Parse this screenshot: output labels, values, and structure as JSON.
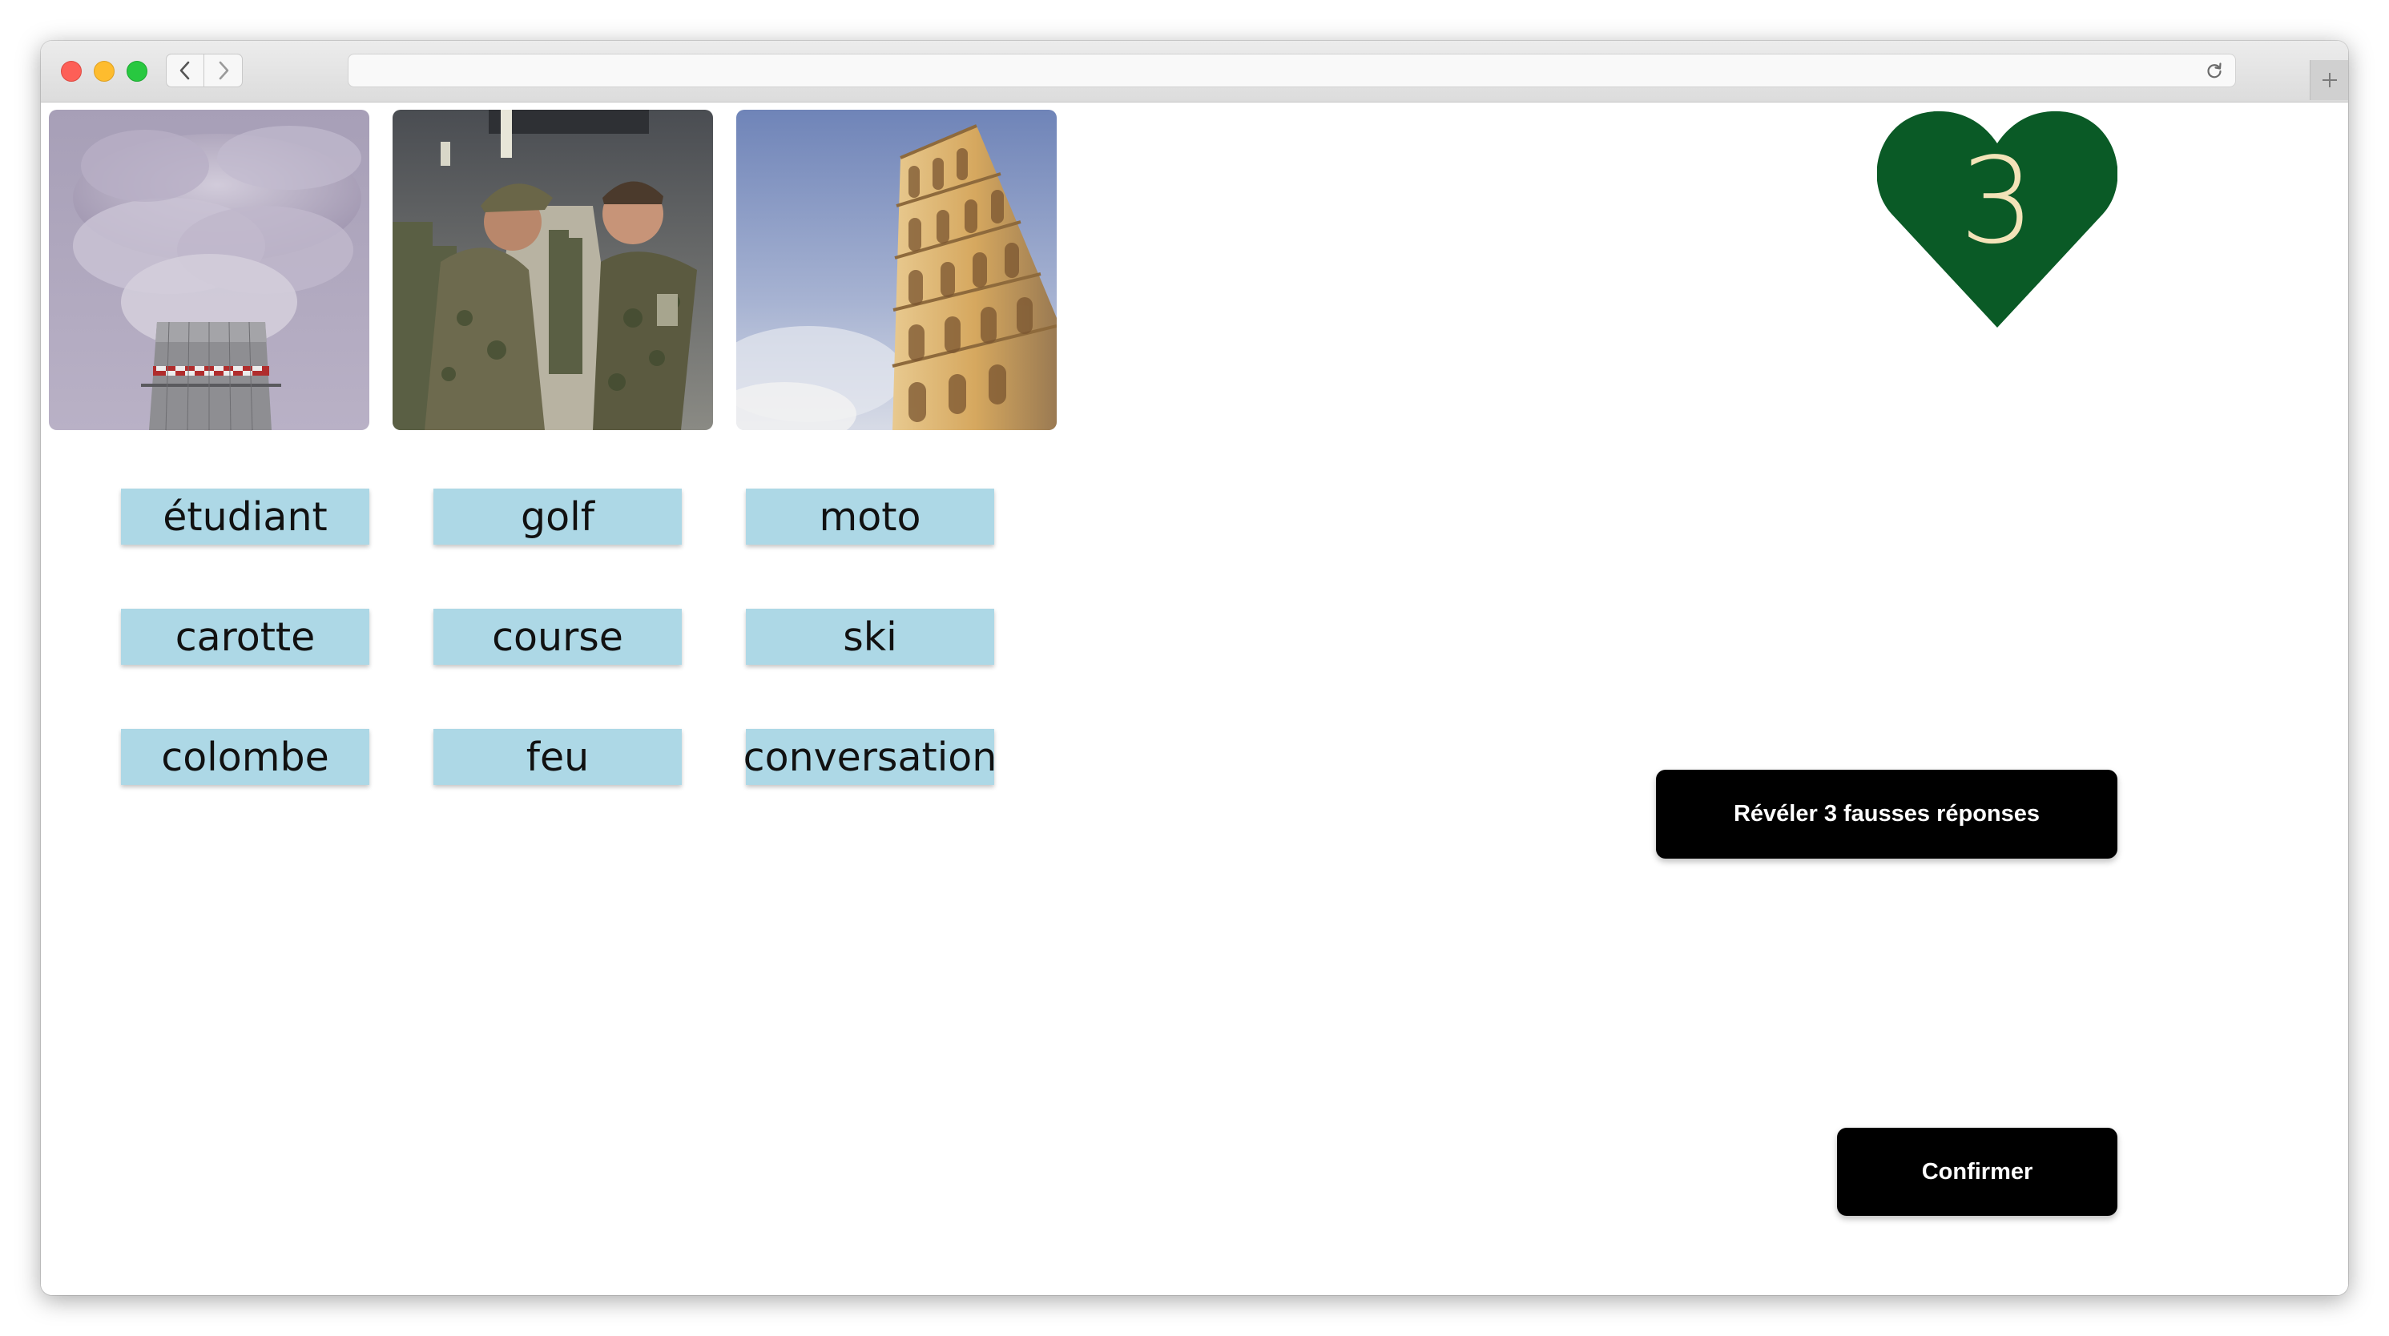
{
  "window": {
    "address_bar_value": ""
  },
  "icons": {
    "back": "chevron-left-icon",
    "forward": "chevron-right-icon",
    "reload": "reload-icon",
    "new_tab": "plus-icon"
  },
  "images": [
    {
      "subject": "cooling-tower-smoke"
    },
    {
      "subject": "soldiers-drill-sergeant"
    },
    {
      "subject": "leaning-tower-of-pisa"
    }
  ],
  "word_tiles": [
    [
      "étudiant",
      "golf",
      "moto"
    ],
    [
      "carotte",
      "course",
      "ski"
    ],
    [
      "colombe",
      "feu",
      "conversation"
    ]
  ],
  "lives": {
    "count": "3",
    "heart_color": "#0a5a26",
    "number_color": "#f3e3b8"
  },
  "buttons": {
    "reveal_label": "Révéler 3 fausses réponses",
    "confirm_label": "Confirmer"
  },
  "colors": {
    "tile_background": "#add8e6",
    "button_background": "#000000"
  }
}
